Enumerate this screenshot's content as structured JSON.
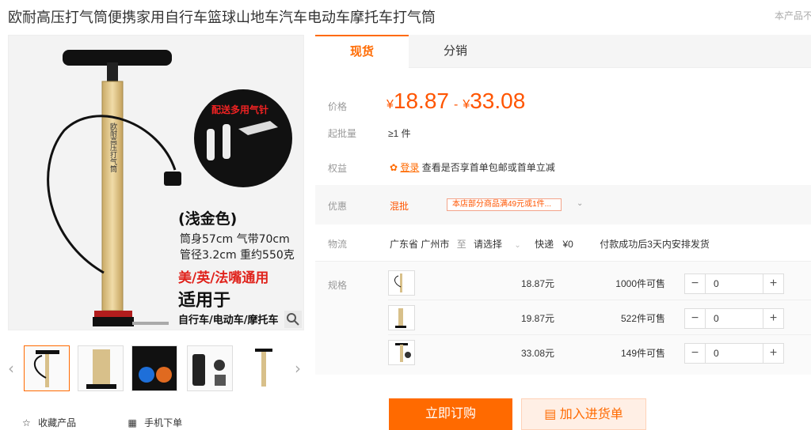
{
  "product": {
    "title": "欧耐高压打气筒便携家用自行车篮球山地车汽车电动车摩托车打气筒",
    "notice": "本产品不"
  },
  "gallery": {
    "main_image": {
      "callout": "配送多用气针",
      "color_name": "(浅金色)",
      "spec_line1": "筒身57cm 气带70cm",
      "spec_line2": "管径3.2cm 重约550克",
      "compat": "美/英/法嘴通用",
      "applies": "适用于",
      "vehicles": "自行车/电动车/摩托车",
      "barrel_text": "欧耐高压打气筒"
    },
    "thumb_count": 5
  },
  "actions": {
    "favorite": "收藏产品",
    "mobile_order": "手机下单"
  },
  "tabs": [
    {
      "label": "现货"
    },
    {
      "label": "分销"
    }
  ],
  "pricing": {
    "label": "价格",
    "currency": "¥",
    "low": "18.87",
    "separator": "-",
    "high": "33.08"
  },
  "moq": {
    "label": "起批量",
    "value": "≥1 件"
  },
  "benefits": {
    "label": "权益",
    "link": "登录",
    "text": "查看是否享首单包邮或首单立减"
  },
  "promotions": {
    "label": "优惠",
    "type": "混批",
    "tag": "本店部分商品满49元或1件..."
  },
  "logistics": {
    "label": "物流",
    "from": "广东省 广州市",
    "to_word": "至",
    "destination": "请选择",
    "express": "快递",
    "fee": "¥0",
    "dispatch": "付款成功后3天内安排发货"
  },
  "specs": {
    "label": "规格",
    "unit": "元",
    "items": [
      {
        "price": "18.87元",
        "stock": "1000件可售",
        "qty": "0"
      },
      {
        "price": "19.87元",
        "stock": "522件可售",
        "qty": "0"
      },
      {
        "price": "33.08元",
        "stock": "149件可售",
        "qty": "0"
      }
    ]
  },
  "buttons": {
    "buy": "立即订购",
    "cart": "加入进货单"
  },
  "colors": {
    "accent": "#ff6a00",
    "price": "#ff5500"
  }
}
